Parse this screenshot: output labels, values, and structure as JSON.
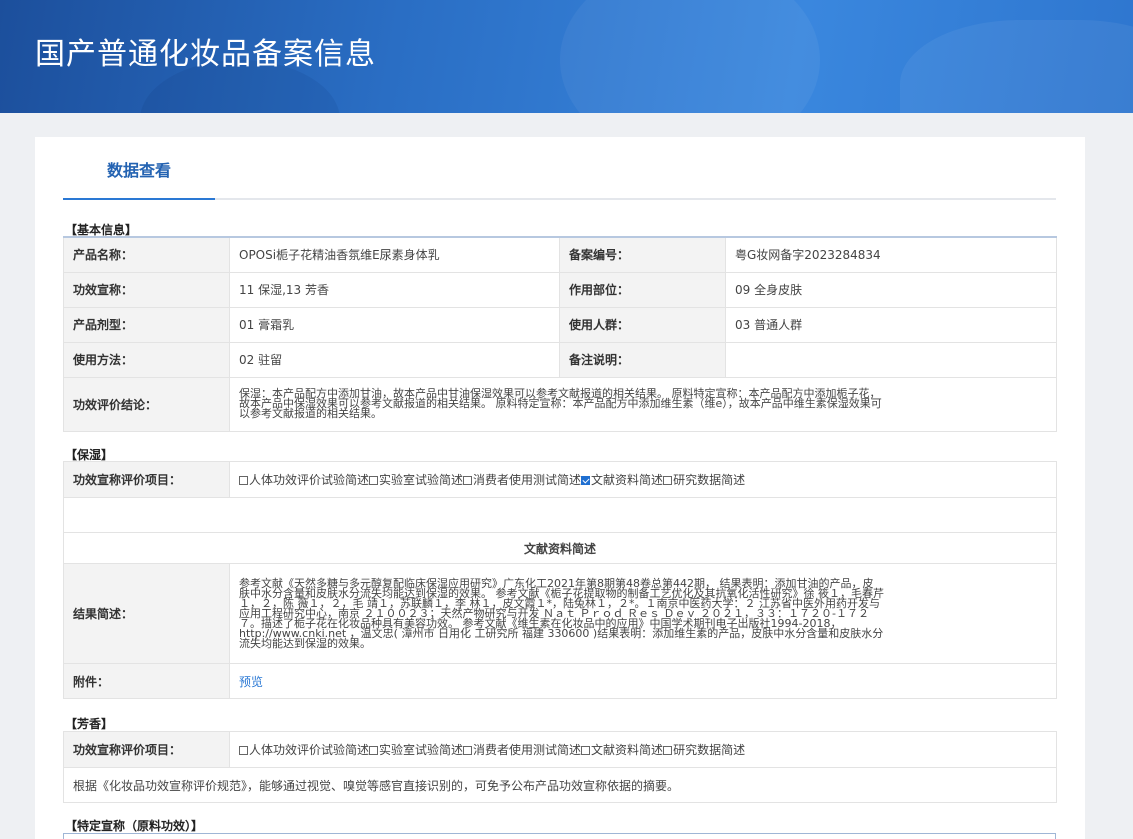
{
  "page_title": "国产普通化妆品备案信息",
  "tab_label": "数据查看",
  "basic": {
    "section_title": "【基本信息】",
    "product_name_label": "产品名称：",
    "product_name": "OPOSi栀子花精油香氛维E尿素身体乳",
    "record_no_label": "备案编号：",
    "record_no": "粤G妆网备字2023284834",
    "efficacy_label": "功效宣称：",
    "efficacy": "11 保湿,13 芳香",
    "site_label": "作用部位：",
    "site": "09 全身皮肤",
    "form_label": "产品剂型：",
    "form": "01 膏霜乳",
    "people_label": "使用人群：",
    "people": "03 普通人群",
    "usage_label": "使用方法：",
    "usage": "02 驻留",
    "remark_label": "备注说明：",
    "remark": "",
    "conclusion_label": "功效评价结论：",
    "conclusion": "保湿：本产品配方中添加甘油，故本产品中甘油保湿效果可以参考文献报道的相关结果。 原料特定宣称：本产品配方中添加栀子花，故本产品中保湿效果可以参考文献报道的相关结果。 原料特定宣称：本产品配方中添加维生素（维e），故本产品中维生素保湿效果可以参考文献报道的相关结果。"
  },
  "moisture": {
    "section_title": "【保湿】",
    "items_label": "功效宣称评价项目：",
    "options": [
      "人体功效评价试验简述",
      "实验室试验简述",
      "消费者使用测试简述",
      "文献资料简述",
      "研究数据简述"
    ],
    "checked": [
      false,
      false,
      false,
      true,
      false
    ],
    "subheader": "文献资料简述",
    "result_label": "结果简述：",
    "result": "参考文献《天然多糖与多元醇复配临床保湿应用研究》广东化工2021年第8期第48卷总第442期， 结果表明：添加甘油的产品，皮肤中水分含量和皮肤水分流失均能达到保湿的效果。 参考文献《栀子花提取物的制备工艺优化及其抗氧化活性研究》徐 筱１，毛春芹１，２，陈 薇１，２，毛 靖１，苏联麟１，李 林１，皮文霞１*，陆兔林１，２*。１南京中医药大学：２ 江苏省中医外用药开发与应用工程研究中心，南京 ２１００２３；天然产物研究与开发 Ｎａｔ Ｐｒｏｄ Ｒｅｓ Ｄｅｖ ２０２１，３３：１７２０-１７２７。描述了栀子花在化妆品种具有美容功效。 参考文献《维生素在化妆品中的应用》中国学术期刊电子出版社1994-2018，http://www.cnki.net ，温文忠( 漳州市 日用化 工研究所 福建 330600 )结果表明：添加维生素的产品，皮肤中水分含量和皮肤水分流失均能达到保湿的效果。",
    "attach_label": "附件：",
    "attach_link": "预览"
  },
  "fragrance": {
    "section_title": "【芳香】",
    "items_label": "功效宣称评价项目：",
    "options": [
      "人体功效评价试验简述",
      "实验室试验简述",
      "消费者使用测试简述",
      "文献资料简述",
      "研究数据简述"
    ],
    "checked": [
      false,
      false,
      false,
      false,
      false
    ],
    "note": "根据《化妆品功效宣称评价规范》，能够通过视觉、嗅觉等感官直接识别的，可免予公布产品功效宣称依据的摘要。"
  },
  "special": {
    "section_title": "【特定宣称（原料功效）】"
  }
}
